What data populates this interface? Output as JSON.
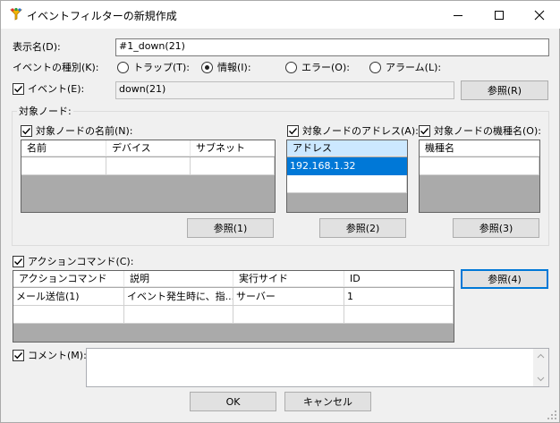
{
  "window": {
    "title": "イベントフィルターの新規作成"
  },
  "display_name": {
    "label": "表示名(D):",
    "value": "#1_down(21)"
  },
  "event_type": {
    "label": "イベントの種別(K):",
    "options": [
      {
        "label": "トラップ(T):",
        "selected": false
      },
      {
        "label": "情報(I):",
        "selected": true
      },
      {
        "label": "エラー(O):",
        "selected": false
      },
      {
        "label": "アラーム(L):",
        "selected": false
      }
    ]
  },
  "event": {
    "label": "イベント(E):",
    "checked": true,
    "value": "down(21)",
    "browse_label": "参照(R)"
  },
  "target_node": {
    "group_label": "対象ノード:",
    "name": {
      "label": "対象ノードの名前(N):",
      "checked": true,
      "columns": [
        "名前",
        "デバイス",
        "サブネット"
      ],
      "browse_label": "参照(1)"
    },
    "address": {
      "label": "対象ノードのアドレス(A):",
      "checked": true,
      "columns": [
        "アドレス"
      ],
      "rows": [
        "192.168.1.32"
      ],
      "browse_label": "参照(2)"
    },
    "model": {
      "label": "対象ノードの機種名(O):",
      "checked": true,
      "columns": [
        "機種名"
      ],
      "browse_label": "参照(3)"
    }
  },
  "action_command": {
    "label": "アクションコマンド(C):",
    "checked": true,
    "columns": [
      "アクションコマンド",
      "説明",
      "実行サイド",
      "ID"
    ],
    "rows": [
      [
        "メール送信(1)",
        "イベント発生時に、指...",
        "サーバー",
        "1"
      ]
    ],
    "browse_label": "参照(4)"
  },
  "comment": {
    "label": "コメント(M):",
    "checked": true,
    "value": ""
  },
  "footer": {
    "ok_label": "OK",
    "cancel_label": "キャンセル"
  }
}
